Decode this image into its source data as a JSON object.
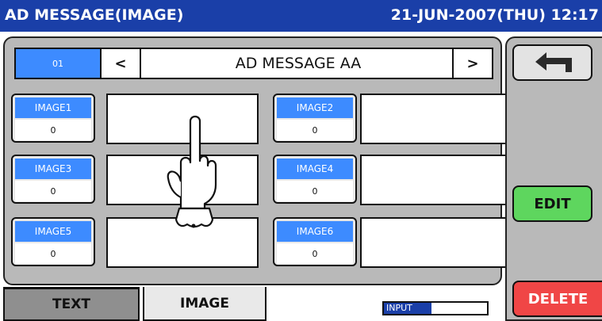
{
  "header": {
    "title": "AD MESSAGE(IMAGE)",
    "datetime": "21-JUN-2007(THU) 12:17"
  },
  "record": {
    "number": "01",
    "prev_label": "<",
    "next_label": ">",
    "name": "AD MESSAGE AA"
  },
  "images": [
    {
      "label": "IMAGE1",
      "value": "0"
    },
    {
      "label": "IMAGE2",
      "value": "0"
    },
    {
      "label": "IMAGE3",
      "value": "0"
    },
    {
      "label": "IMAGE4",
      "value": "0"
    },
    {
      "label": "IMAGE5",
      "value": "0"
    },
    {
      "label": "IMAGE6",
      "value": "0"
    }
  ],
  "tabs": {
    "text": "TEXT",
    "image": "IMAGE"
  },
  "status": {
    "input_label": "INPUT"
  },
  "side": {
    "return_icon": "return-arrow-icon",
    "edit_label": "EDIT",
    "delete_label": "DELETE"
  },
  "colors": {
    "title_bar": "#1a3fa8",
    "key_label": "#3d8bff",
    "edit": "#5ed65e",
    "delete": "#f04646",
    "panel": "#b9b9b9"
  }
}
